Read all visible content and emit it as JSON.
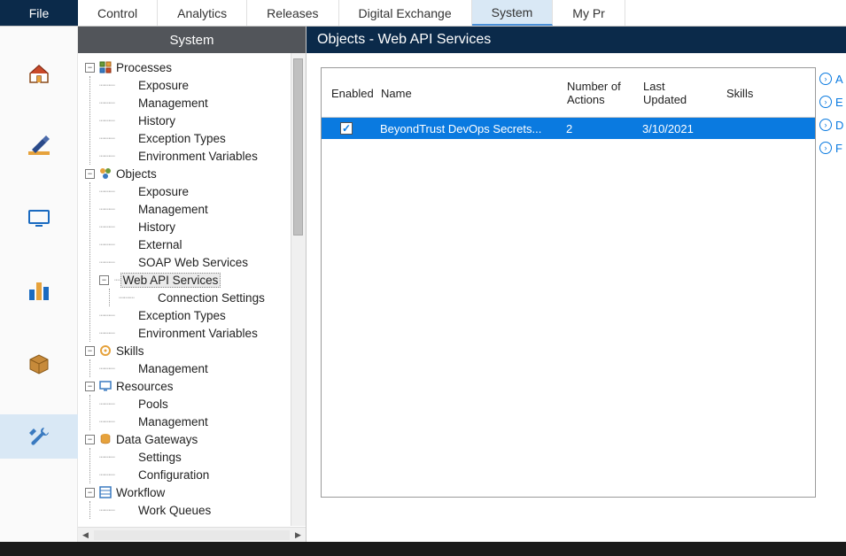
{
  "menubar": {
    "file": "File",
    "tabs": [
      "Control",
      "Analytics",
      "Releases",
      "Digital Exchange",
      "System",
      "My Pr"
    ],
    "active_index": 4
  },
  "iconstrip": {
    "items": [
      "home",
      "design",
      "monitor",
      "chart",
      "package",
      "tools"
    ],
    "active_index": 5
  },
  "tree": {
    "header": "System",
    "nodes": [
      {
        "label": "Processes",
        "icon": "processes",
        "children": [
          "Exposure",
          "Management",
          "History",
          "Exception Types",
          "Environment Variables"
        ]
      },
      {
        "label": "Objects",
        "icon": "objects",
        "children_pre": [
          "Exposure",
          "Management",
          "History",
          "External",
          "SOAP Web Services"
        ],
        "selected_child": {
          "label": "Web API Services",
          "grandchild": "Connection Settings"
        },
        "children_post": [
          "Exception Types",
          "Environment Variables"
        ]
      },
      {
        "label": "Skills",
        "icon": "skills",
        "children": [
          "Management"
        ]
      },
      {
        "label": "Resources",
        "icon": "resources",
        "children": [
          "Pools",
          "Management"
        ]
      },
      {
        "label": "Data Gateways",
        "icon": "gateways",
        "children": [
          "Settings",
          "Configuration"
        ]
      },
      {
        "label": "Workflow",
        "icon": "workflow",
        "children": [
          "Work Queues"
        ]
      }
    ]
  },
  "main": {
    "title": "Objects - Web API Services",
    "columns": {
      "c1": "Enabled",
      "c2": "Name",
      "c3": "Number of Actions",
      "c4": "Last Updated",
      "c5": "Skills"
    },
    "row": {
      "enabled": true,
      "name": "BeyondTrust DevOps Secrets...",
      "actions": "2",
      "updated": "3/10/2021",
      "skills": ""
    }
  },
  "actions": [
    "A",
    "E",
    "D",
    "F"
  ],
  "statusbar": ""
}
